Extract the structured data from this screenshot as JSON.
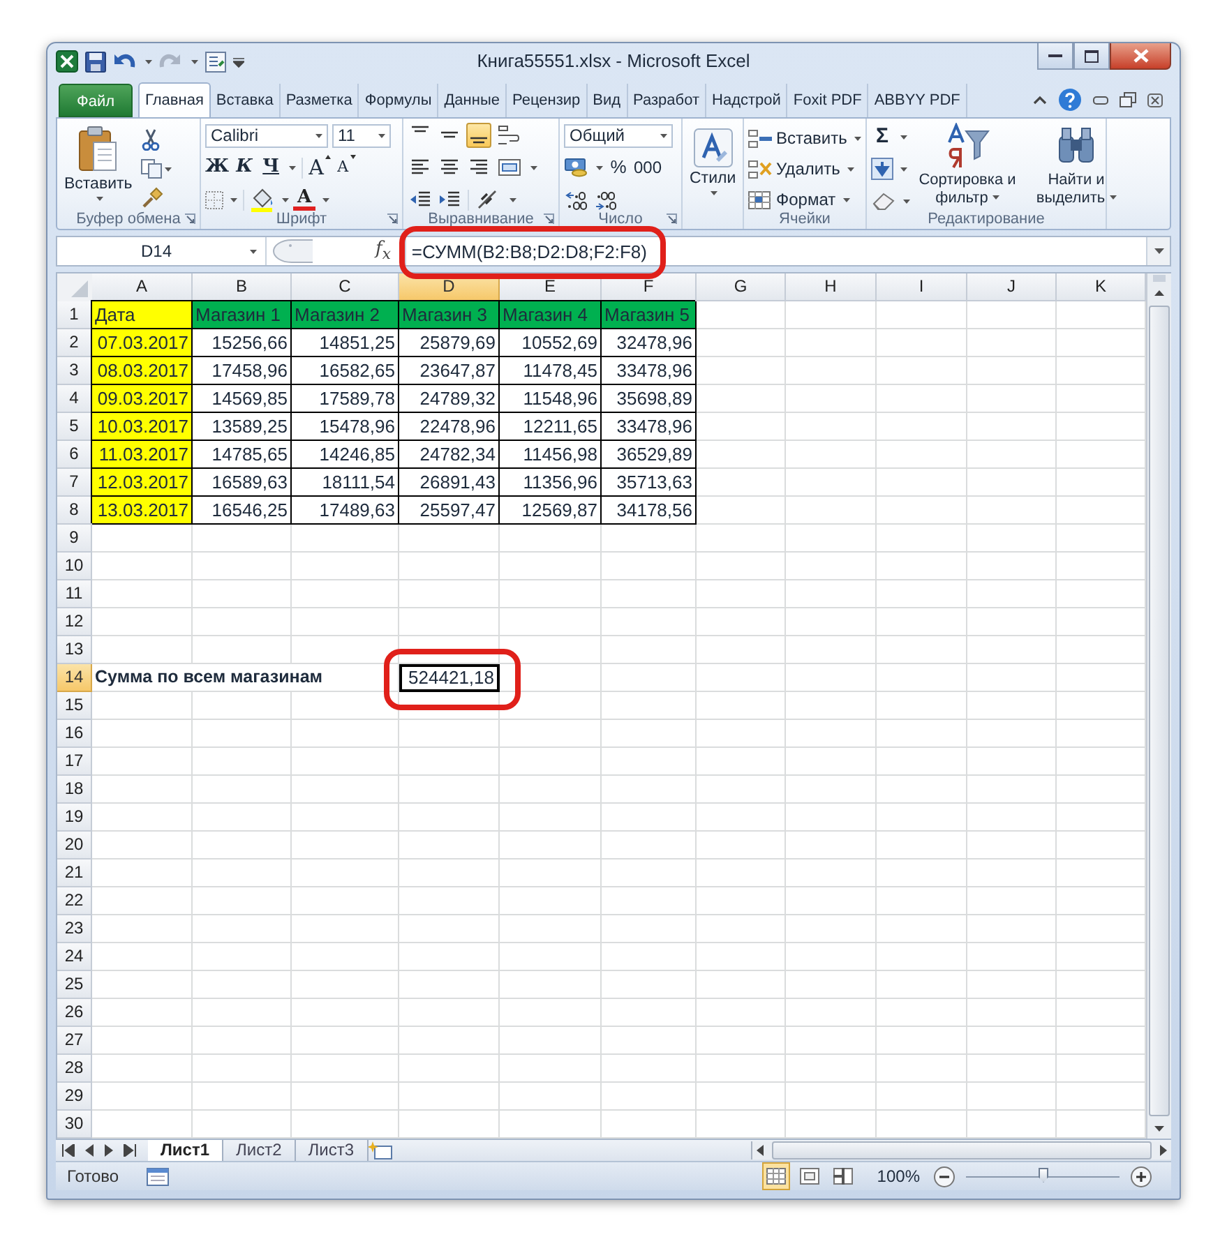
{
  "window": {
    "title": "Книга55551.xlsx - Microsoft Excel"
  },
  "tabs": [
    {
      "label": "Файл",
      "kind": "file",
      "selected": false
    },
    {
      "label": "Главная",
      "kind": "tab",
      "selected": true
    },
    {
      "label": "Вставка",
      "kind": "tab",
      "selected": false
    },
    {
      "label": "Разметка",
      "kind": "tab",
      "selected": false
    },
    {
      "label": "Формулы",
      "kind": "tab",
      "selected": false
    },
    {
      "label": "Данные",
      "kind": "tab",
      "selected": false
    },
    {
      "label": "Рецензир",
      "kind": "tab",
      "selected": false
    },
    {
      "label": "Вид",
      "kind": "tab",
      "selected": false
    },
    {
      "label": "Разработ",
      "kind": "tab",
      "selected": false
    },
    {
      "label": "Надстрой",
      "kind": "tab",
      "selected": false
    },
    {
      "label": "Foxit PDF",
      "kind": "tab",
      "selected": false
    },
    {
      "label": "ABBYY PDF",
      "kind": "tab",
      "selected": false
    }
  ],
  "ribbon": {
    "groups": [
      {
        "kind": "clipboard",
        "label": "Буфер обмена",
        "launcher": true,
        "paste": "Вставить"
      },
      {
        "kind": "font",
        "label": "Шрифт",
        "launcher": true,
        "family": "Calibri",
        "size": "11",
        "bold": "Ж",
        "italic": "К",
        "underline": "Ч",
        "grow": "A",
        "shrink": "A",
        "color_letter": "A"
      },
      {
        "kind": "alignment",
        "label": "Выравнивание",
        "launcher": true,
        "vertical": [
          {
            "selected": false
          },
          {
            "selected": false
          },
          {
            "selected": true
          }
        ]
      },
      {
        "kind": "number",
        "label": "Число",
        "launcher": true,
        "format": "Общий",
        "percent": "%",
        "thousands": "000"
      },
      {
        "kind": "styles",
        "button": "Стили"
      },
      {
        "kind": "cells",
        "label": "Ячейки",
        "buttons": [
          "Вставить",
          "Удалить",
          "Формат"
        ]
      },
      {
        "kind": "editing",
        "label": "Редактирование",
        "sum": "Σ",
        "sort": "Сортировка и фильтр",
        "find": "Найти и выделить"
      }
    ]
  },
  "formula_bar": {
    "name_box": "D14",
    "function_label": "f$_{x}$",
    "formula": "=СУММ(B2:B8;D2:D8;F2:F8)",
    "highlighted": true
  },
  "sheet": {
    "columns": [
      {
        "label": "A",
        "selected": false
      },
      {
        "label": "B",
        "selected": false
      },
      {
        "label": "C",
        "selected": false
      },
      {
        "label": "D",
        "selected": true
      },
      {
        "label": "E",
        "selected": false
      },
      {
        "label": "F",
        "selected": false
      },
      {
        "label": "G",
        "selected": false
      },
      {
        "label": "H",
        "selected": false
      },
      {
        "label": "I",
        "selected": false
      },
      {
        "label": "J",
        "selected": false
      },
      {
        "label": "K",
        "selected": false
      }
    ],
    "rows": [
      {
        "number": "1",
        "selected": false,
        "cells": [
          {
            "text": "Дата",
            "kind": "text",
            "color": "#ffff00",
            "outlined": true,
            "selected": false,
            "highlighted": false
          },
          {
            "text": "Магазин 1",
            "kind": "text",
            "color": "#00b050",
            "outlined": true,
            "selected": false,
            "highlighted": false
          },
          {
            "text": "Магазин 2",
            "kind": "text",
            "color": "#00b050",
            "outlined": true,
            "selected": false,
            "highlighted": false
          },
          {
            "text": "Магазин 3",
            "kind": "text",
            "color": "#00b050",
            "outlined": true,
            "selected": false,
            "highlighted": false
          },
          {
            "text": "Магазин 4",
            "kind": "text",
            "color": "#00b050",
            "outlined": true,
            "selected": false,
            "highlighted": false
          },
          {
            "text": "Магазин 5",
            "kind": "text",
            "color": "#00b050",
            "outlined": true,
            "selected": false,
            "highlighted": false
          }
        ]
      },
      {
        "number": "2",
        "selected": false,
        "cells": [
          {
            "text": "07.03.2017",
            "kind": "date",
            "color": "#ffff00",
            "outlined": true,
            "selected": false,
            "highlighted": false
          },
          {
            "text": "15256,66",
            "kind": "number",
            "outlined": true,
            "selected": false,
            "highlighted": false
          },
          {
            "text": "14851,25",
            "kind": "number",
            "outlined": true,
            "selected": false,
            "highlighted": false
          },
          {
            "text": "25879,69",
            "kind": "number",
            "outlined": true,
            "selected": false,
            "highlighted": false
          },
          {
            "text": "10552,69",
            "kind": "number",
            "outlined": true,
            "selected": false,
            "highlighted": false
          },
          {
            "text": "32478,96",
            "kind": "number",
            "outlined": true,
            "selected": false,
            "highlighted": false
          }
        ]
      },
      {
        "number": "3",
        "selected": false,
        "cells": [
          {
            "text": "08.03.2017",
            "kind": "date",
            "color": "#ffff00",
            "outlined": true,
            "selected": false,
            "highlighted": false
          },
          {
            "text": "17458,96",
            "kind": "number",
            "outlined": true,
            "selected": false,
            "highlighted": false
          },
          {
            "text": "16582,65",
            "kind": "number",
            "outlined": true,
            "selected": false,
            "highlighted": false
          },
          {
            "text": "23647,87",
            "kind": "number",
            "outlined": true,
            "selected": false,
            "highlighted": false
          },
          {
            "text": "11478,45",
            "kind": "number",
            "outlined": true,
            "selected": false,
            "highlighted": false
          },
          {
            "text": "33478,96",
            "kind": "number",
            "outlined": true,
            "selected": false,
            "highlighted": false
          }
        ]
      },
      {
        "number": "4",
        "selected": false,
        "cells": [
          {
            "text": "09.03.2017",
            "kind": "date",
            "color": "#ffff00",
            "outlined": true,
            "selected": false,
            "highlighted": false
          },
          {
            "text": "14569,85",
            "kind": "number",
            "outlined": true,
            "selected": false,
            "highlighted": false
          },
          {
            "text": "17589,78",
            "kind": "number",
            "outlined": true,
            "selected": false,
            "highlighted": false
          },
          {
            "text": "24789,32",
            "kind": "number",
            "outlined": true,
            "selected": false,
            "highlighted": false
          },
          {
            "text": "11548,96",
            "kind": "number",
            "outlined": true,
            "selected": false,
            "highlighted": false
          },
          {
            "text": "35698,89",
            "kind": "number",
            "outlined": true,
            "selected": false,
            "highlighted": false
          }
        ]
      },
      {
        "number": "5",
        "selected": false,
        "cells": [
          {
            "text": "10.03.2017",
            "kind": "date",
            "color": "#ffff00",
            "outlined": true,
            "selected": false,
            "highlighted": false
          },
          {
            "text": "13589,25",
            "kind": "number",
            "outlined": true,
            "selected": false,
            "highlighted": false
          },
          {
            "text": "15478,96",
            "kind": "number",
            "outlined": true,
            "selected": false,
            "highlighted": false
          },
          {
            "text": "22478,96",
            "kind": "number",
            "outlined": true,
            "selected": false,
            "highlighted": false
          },
          {
            "text": "12211,65",
            "kind": "number",
            "outlined": true,
            "selected": false,
            "highlighted": false
          },
          {
            "text": "33478,96",
            "kind": "number",
            "outlined": true,
            "selected": false,
            "highlighted": false
          }
        ]
      },
      {
        "number": "6",
        "selected": false,
        "cells": [
          {
            "text": "11.03.2017",
            "kind": "date",
            "color": "#ffff00",
            "outlined": true,
            "selected": false,
            "highlighted": false
          },
          {
            "text": "14785,65",
            "kind": "number",
            "outlined": true,
            "selected": false,
            "highlighted": false
          },
          {
            "text": "14246,85",
            "kind": "number",
            "outlined": true,
            "selected": false,
            "highlighted": false
          },
          {
            "text": "24782,34",
            "kind": "number",
            "outlined": true,
            "selected": false,
            "highlighted": false
          },
          {
            "text": "11456,98",
            "kind": "number",
            "outlined": true,
            "selected": false,
            "highlighted": false
          },
          {
            "text": "36529,89",
            "kind": "number",
            "outlined": true,
            "selected": false,
            "highlighted": false
          }
        ]
      },
      {
        "number": "7",
        "selected": false,
        "cells": [
          {
            "text": "12.03.2017",
            "kind": "date",
            "color": "#ffff00",
            "outlined": true,
            "selected": false,
            "highlighted": false
          },
          {
            "text": "16589,63",
            "kind": "number",
            "outlined": true,
            "selected": false,
            "highlighted": false
          },
          {
            "text": "18111,54",
            "kind": "number",
            "outlined": true,
            "selected": false,
            "highlighted": false
          },
          {
            "text": "26891,43",
            "kind": "number",
            "outlined": true,
            "selected": false,
            "highlighted": false
          },
          {
            "text": "11356,96",
            "kind": "number",
            "outlined": true,
            "selected": false,
            "highlighted": false
          },
          {
            "text": "35713,63",
            "kind": "number",
            "outlined": true,
            "selected": false,
            "highlighted": false
          }
        ]
      },
      {
        "number": "8",
        "selected": false,
        "cells": [
          {
            "text": "13.03.2017",
            "kind": "date",
            "color": "#ffff00",
            "outlined": true,
            "selected": false,
            "highlighted": false
          },
          {
            "text": "16546,25",
            "kind": "number",
            "outlined": true,
            "selected": false,
            "highlighted": false
          },
          {
            "text": "17489,63",
            "kind": "number",
            "outlined": true,
            "selected": false,
            "highlighted": false
          },
          {
            "text": "25597,47",
            "kind": "number",
            "outlined": true,
            "selected": false,
            "highlighted": false
          },
          {
            "text": "12569,87",
            "kind": "number",
            "outlined": true,
            "selected": false,
            "highlighted": false
          },
          {
            "text": "34178,56",
            "kind": "number",
            "outlined": true,
            "selected": false,
            "highlighted": false
          }
        ]
      },
      {
        "number": "9",
        "selected": false
      },
      {
        "number": "10",
        "selected": false
      },
      {
        "number": "11",
        "selected": false
      },
      {
        "number": "12",
        "selected": false
      },
      {
        "number": "13",
        "selected": false
      },
      {
        "number": "14",
        "selected": true,
        "cells": [
          {
            "text": "Сумма по всем магазинам",
            "kind": "label",
            "outlined": false,
            "selected": false,
            "highlighted": false
          },
          null,
          null,
          {
            "text": "524421,18",
            "kind": "number",
            "outlined": false,
            "selected": true,
            "highlighted": true
          }
        ]
      },
      {
        "number": "15",
        "selected": false
      },
      {
        "number": "16",
        "selected": false
      },
      {
        "number": "17",
        "selected": false
      },
      {
        "number": "18",
        "selected": false
      },
      {
        "number": "19",
        "selected": false
      },
      {
        "number": "20",
        "selected": false
      },
      {
        "number": "21",
        "selected": false
      },
      {
        "number": "22",
        "selected": false
      },
      {
        "number": "23",
        "selected": false
      },
      {
        "number": "24",
        "selected": false
      },
      {
        "number": "25",
        "selected": false
      },
      {
        "number": "26",
        "selected": false
      },
      {
        "number": "27",
        "selected": false
      },
      {
        "number": "28",
        "selected": false
      },
      {
        "number": "29",
        "selected": false
      },
      {
        "number": "30",
        "selected": false
      }
    ]
  },
  "sheet_tabs": [
    {
      "label": "Лист1",
      "selected": true
    },
    {
      "label": "Лист2",
      "selected": false
    },
    {
      "label": "Лист3",
      "selected": false
    }
  ],
  "status_bar": {
    "status": "Готово",
    "views": [
      {
        "selected": true
      },
      {
        "selected": false
      },
      {
        "selected": false
      }
    ],
    "zoom": "100%",
    "zoom_slider": {
      "level": 0.5
    }
  }
}
